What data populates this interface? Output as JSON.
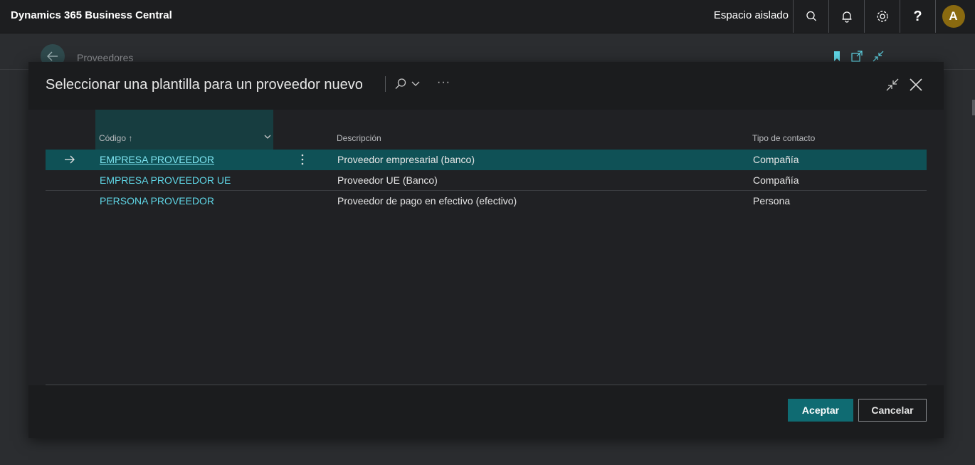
{
  "topbar": {
    "app_title": "Dynamics 365 Business Central",
    "environment": "Espacio aislado",
    "help_label": "?",
    "avatar_initial": "A",
    "icons": [
      "search-icon",
      "bell-icon",
      "gear-icon",
      "help-icon"
    ]
  },
  "background_page": {
    "title": "Proveedores",
    "icons": [
      "back-icon",
      "bookmark-icon",
      "open-in-new-icon",
      "collapse-icon"
    ]
  },
  "dialog": {
    "title": "Seleccionar una plantilla para un proveedor nuevo",
    "more_label": "···",
    "columns": {
      "code": "Código ↑",
      "description": "Descripción",
      "contact_type": "Tipo de contacto"
    },
    "rows": [
      {
        "code": "EMPRESA PROVEEDOR",
        "description": "Proveedor empresarial (banco)",
        "contact_type": "Compañía",
        "selected": true
      },
      {
        "code": "EMPRESA PROVEEDOR UE",
        "description": "Proveedor UE (Banco)",
        "contact_type": "Compañía",
        "selected": false
      },
      {
        "code": "PERSONA PROVEEDOR",
        "description": "Proveedor de pago en efectivo (efectivo)",
        "contact_type": "Persona",
        "selected": false
      }
    ],
    "buttons": {
      "ok": "Aceptar",
      "cancel": "Cancelar"
    }
  },
  "colors": {
    "accent": "#0f6b72",
    "selected_row": "#0f5156",
    "link": "#5fd6e6",
    "avatar": "#8a6a10"
  }
}
